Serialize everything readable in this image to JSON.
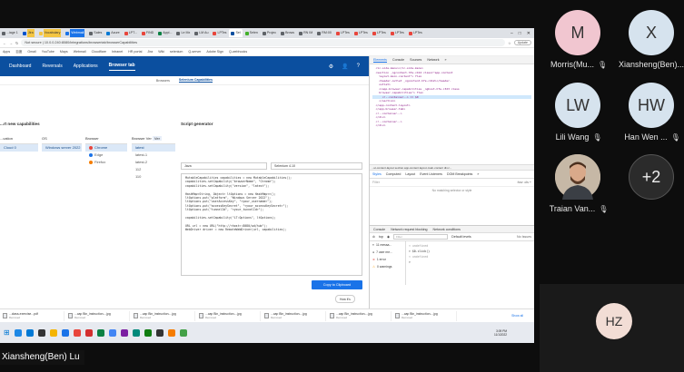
{
  "browser": {
    "tabs": [
      {
        "label": "...iage 1",
        "fav": "#5f6368"
      },
      {
        "label": "Jira",
        "fav": "#0052cc",
        "badge": "yellow"
      },
      {
        "label": "Vocabulary",
        "fav": "#f4c542",
        "badge": "yellow"
      },
      {
        "label": "Webmail",
        "fav": "#1a73e8",
        "badge": "blue"
      },
      {
        "label": "Sales",
        "fav": "#5f6368"
      },
      {
        "label": "Azure",
        "fav": "#0078d4"
      },
      {
        "label": "LPT...",
        "fav": "#e8453c"
      },
      {
        "label": "FIND",
        "fav": "#e8453c"
      },
      {
        "label": "Appl...",
        "fav": "#0b8043"
      },
      {
        "label": "Le Mx",
        "fav": "#5f6368"
      },
      {
        "label": "LM Au",
        "fav": "#5f6368"
      },
      {
        "label": "LPTes",
        "fav": "#e8453c"
      },
      {
        "label": "Sel",
        "fav": "#0b4f9f",
        "active": true
      },
      {
        "label": "Selen",
        "fav": "#43b02a"
      },
      {
        "label": "Projec",
        "fav": "#5f6368"
      },
      {
        "label": "Brows",
        "fav": "#5f6368"
      },
      {
        "label": "RN IM",
        "fav": "#5f6368"
      },
      {
        "label": "RM:00",
        "fav": "#5f6368"
      },
      {
        "label": "LPTes",
        "fav": "#e8453c"
      },
      {
        "label": "LPTes",
        "fav": "#e8453c"
      },
      {
        "label": "LPTes",
        "fav": "#e8453c"
      },
      {
        "label": "LPTes",
        "fav": "#e8453c"
      },
      {
        "label": "LPTes",
        "fav": "#e8453c"
      }
    ],
    "url": "Not secure | 10.0.0.240:8080/integrations/browsertab/browserCapabilities",
    "profile": "Update",
    "bookmarks": [
      "Apps",
      "百度",
      "Gmail",
      "YouTube",
      "Maps",
      "Webmail",
      "Cloudflare",
      "Intranet",
      "HR portal",
      "Jira",
      "Wiki",
      "selenium",
      "Q-server",
      "Adobe Sign",
      "Q-webhooks"
    ],
    "window_controls": [
      "–",
      "□",
      "✕"
    ]
  },
  "app": {
    "nav": [
      "Dashboard",
      "Reversals",
      "Applications",
      "Browser tab"
    ],
    "nav_selected": 3,
    "subtabs": [
      "Browsers",
      "Selenium Capabilities"
    ],
    "subtab_selected": 1,
    "left_title": "...rt new capabilities",
    "script_title": "Script generator",
    "columns": {
      "location": {
        "header": "...cation",
        "options": [
          {
            "label": "Cloud 0",
            "selected": true
          }
        ]
      },
      "os": {
        "header": "OS",
        "options": [
          {
            "label": "Windows server 2022",
            "selected": true
          }
        ]
      },
      "browser": {
        "header": "Browser",
        "options": [
          {
            "label": "Chrome",
            "selected": true,
            "color": "#e8453c"
          },
          {
            "label": "Edge",
            "color": "#1a73e8"
          },
          {
            "label": "Firefox",
            "color": "#f57c00"
          }
        ]
      },
      "version": {
        "header": "Browser Ver",
        "badge": "Ver",
        "options": [
          {
            "label": "latest",
            "selected": true
          },
          {
            "label": "latest-1"
          },
          {
            "label": "latest-2"
          },
          {
            "label": "112"
          },
          {
            "label": "110"
          }
        ]
      }
    },
    "lang_select": "Java",
    "framework_select": "Selenium 4.10",
    "code": "MutableCapabilities capabilities = new MutableCapabilities();\ncapabilities.setCapability(\"browserName\", \"Chrome\");\ncapabilities.setCapability(\"version\", \"latest\");\n\nHashMap<String, Object> ltOptions = new HashMap<>();\nltOptions.put(\"platform\", \"Windows Server 2022\");\nltOptions.put(\"userAccessKey\", \"<your_username>\");\nltOptions.put(\"accessKeySecret\", \"<your_accessKeySecret>\");\nltOptions.put(\"tunnelId\", \"<your_tunnelId>\");\n\ncapabilities.setCapability(\"LT:Options\", ltOptions);\n\nURL url = new URL(\"http://<host>:8080/wd/hub\");\nWebDriver driver = new RemoteWebDriver(url, capabilities);",
    "copy_button": "Copy to Clipboard"
  },
  "devtools": {
    "tabs": [
      "Elements",
      "Console",
      "Sources",
      "Network",
      "»"
    ],
    "tab_selected": 0,
    "dom_lines": [
      "  <lc-side-menu></lc-side-menu>",
      "  <section _ngcontent-hfe-c412 class=\"app-content",
      "    layout-main-content\"> flex",
      "    <header-outlet _ngcontent-hfe-c412></header-",
      "    outlet>",
      "    <capp-browser-capabilities _nghost-hfe-c323 class",
      "    browser-capabilities\"> flex",
      "      <!--container--> == $0",
      "    </section>",
      "  </app-content-layout>",
      "  </app-browser-tab>",
      "  <!--container-->",
      "  </div>",
      "  <!--container-->",
      "  </div>"
    ],
    "dom_highlight": 7,
    "breadcrumb": "...ut-content-layout   section.app-content.layout-main-content   div.c...",
    "subtabs": [
      "Styles",
      "Computed",
      "Layout",
      "Event Listeners",
      "DOM Breakpoints",
      "»"
    ],
    "subtab_selected": 0,
    "filter_placeholder": "Filter",
    "filter_right": ":hov  .cls  +",
    "no_match": "No matching selector or style",
    "console_tabs": [
      "Console",
      "Network request blocking",
      "Network conditions"
    ],
    "console_tab_selected": 0,
    "context": "top",
    "console_filter": "Filter",
    "issues": "No Issues",
    "levels": "Default levels",
    "messages": [
      {
        "icon": "≡",
        "label": "11 messa...",
        "color": "#555"
      },
      {
        "icon": "●",
        "label": "7 user me...",
        "color": "#555"
      },
      {
        "icon": "⨯",
        "label": "1 error",
        "color": "#d93025"
      },
      {
        "icon": "⚠",
        "label": "0 warnings",
        "color": "#f9a825"
      }
    ],
    "output": [
      "< undefined",
      "> $0.click()",
      "< undefined",
      ">"
    ]
  },
  "downloads": [
    {
      "name": "...class-exercise...pdf",
      "sub": "Removed"
    },
    {
      "name": "...cap Bin_instruction....jpg",
      "sub": "Removed"
    },
    {
      "name": "...cap Bin_instruction....jpg",
      "sub": "Removed"
    },
    {
      "name": "...cap Bin_instruction....jpg",
      "sub": "Removed"
    },
    {
      "name": "...cap Bin_instruction....jpg",
      "sub": "Removed"
    },
    {
      "name": "...cap Bin_instruction....jpg",
      "sub": "Removed"
    },
    {
      "name": "...cap Bin_instruction....jpg",
      "sub": "Removed"
    }
  ],
  "downloads_show_all": "Show all",
  "toast": "How it's",
  "taskbar": {
    "icons": [
      "#1e88e5",
      "#0078d4",
      "#333333",
      "#f4b400",
      "#1a73e8",
      "#e8453c",
      "#d32f2f",
      "#0b8043",
      "#4285f4",
      "#7b1fa2",
      "#00897b",
      "#107c10",
      "#333333",
      "#f57c00",
      "#43a047"
    ],
    "time": "3:09 PM",
    "date": "11/1/2022"
  },
  "participants": [
    {
      "initial": "M",
      "name": "Morris(Mu...",
      "bg": "#f1c6d0",
      "muted": true
    },
    {
      "initial": "X",
      "name": "Xiansheng(Ben)...",
      "bg": "#d6e3ee",
      "muted": false
    },
    {
      "initial": "LW",
      "name": "Lili Wang",
      "bg": "#d6e3ee",
      "muted": true
    },
    {
      "initial": "HW",
      "name": "Han Wen ...",
      "bg": "#d6e3ee",
      "muted": true
    },
    {
      "initial": "",
      "name": "Traian Van...",
      "bg": "#c6b8a6",
      "muted": true,
      "photo": true
    },
    {
      "initial": "+2",
      "name": "",
      "bg": "#2b2b2b",
      "muted": false
    }
  ],
  "self": {
    "initial": "HZ",
    "bg": "#f2ddd5"
  },
  "active_speaker": "Xiansheng(Ben) Lu"
}
